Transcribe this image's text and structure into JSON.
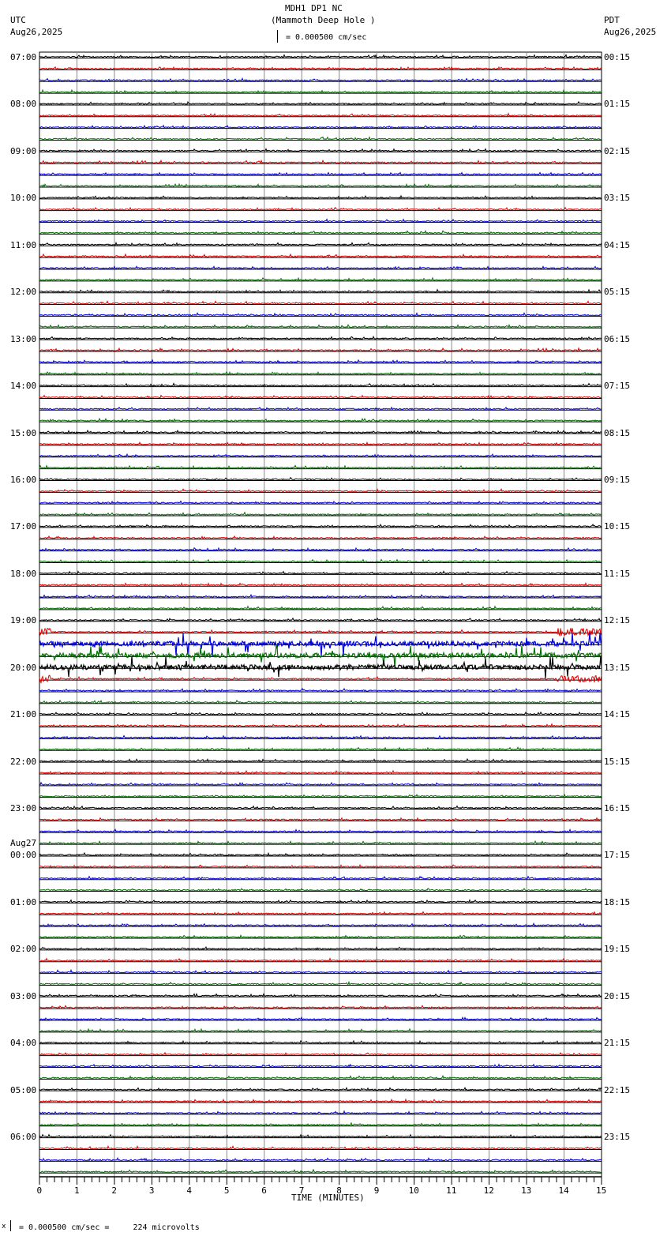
{
  "header": {
    "station": "MDH1 DP1 NC",
    "location": "(Mammoth Deep Hole )",
    "scale": "= 0.000500 cm/sec",
    "left_tz": "UTC",
    "left_date": "Aug26,2025",
    "right_tz": "PDT",
    "right_date": "Aug26,2025"
  },
  "footer": {
    "scale_note": "= 0.000500 cm/sec =     224 microvolts",
    "marker": "x"
  },
  "chart_data": {
    "type": "helicorder",
    "title": "MDH1 DP1 NC (Mammoth Deep Hole )",
    "xlabel": "TIME (MINUTES)",
    "xlim": [
      0,
      15
    ],
    "x_ticks": [
      "0",
      "1",
      "2",
      "3",
      "4",
      "5",
      "6",
      "7",
      "8",
      "9",
      "10",
      "11",
      "12",
      "13",
      "14",
      "15"
    ],
    "traces_per_hour": 4,
    "trace_colors": [
      "#000000",
      "#e00000",
      "#0000e0",
      "#007000"
    ],
    "left_labels": [
      "07:00",
      "08:00",
      "09:00",
      "10:00",
      "11:00",
      "12:00",
      "13:00",
      "14:00",
      "15:00",
      "16:00",
      "17:00",
      "18:00",
      "19:00",
      "20:00",
      "21:00",
      "22:00",
      "23:00",
      "00:00",
      "01:00",
      "02:00",
      "03:00",
      "04:00",
      "05:00",
      "06:00"
    ],
    "date_change_label": "Aug27",
    "right_labels": [
      "00:15",
      "01:15",
      "02:15",
      "03:15",
      "04:15",
      "05:15",
      "06:15",
      "07:15",
      "08:15",
      "09:15",
      "10:15",
      "11:15",
      "12:15",
      "13:15",
      "14:15",
      "15:15",
      "16:15",
      "17:15",
      "18:15",
      "19:15",
      "20:15",
      "21:15",
      "22:15",
      "23:15"
    ],
    "high_activity_traces": [
      {
        "start": "19:15",
        "level": 0.4
      },
      {
        "start": "19:30",
        "level": 1
      },
      {
        "start": "19:45",
        "level": 1
      },
      {
        "start": "20:00",
        "level": 1
      },
      {
        "start": "20:15",
        "level": 0.3
      }
    ]
  }
}
